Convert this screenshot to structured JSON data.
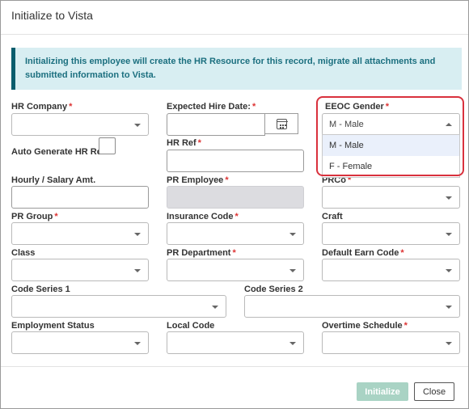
{
  "dialog": {
    "title": "Initialize to Vista",
    "info": "Initializing this employee will create the HR Resource for this record, migrate all attachments and submitted information to Vista."
  },
  "fields": {
    "hr_company": "HR Company",
    "expected_hire_date": "Expected Hire Date:",
    "eeoc_gender": "EEOC Gender",
    "auto_generate_hr_ref": "Auto Generate HR Ref",
    "hr_ref": "HR Ref",
    "hourly_salary": "Hourly / Salary Amt.",
    "pr_employee": "PR Employee",
    "prco": "PRCo",
    "pr_group": "PR Group",
    "insurance_code": "Insurance Code",
    "craft": "Craft",
    "class": "Class",
    "pr_department": "PR Department",
    "default_earn_code": "Default Earn Code",
    "code_series_1": "Code Series 1",
    "code_series_2": "Code Series 2",
    "employment_status": "Employment Status",
    "local_code": "Local Code",
    "overtime_schedule": "Overtime Schedule"
  },
  "required_mark": "*",
  "eeoc_gender": {
    "value": "M - Male",
    "options": [
      "M - Male",
      "F - Female"
    ]
  },
  "buttons": {
    "initialize": "Initialize",
    "close": "Close"
  },
  "colors": {
    "accent": "#0a5d6d",
    "info_bg": "#d8eef2",
    "required": "#d33333",
    "highlight": "#d9313d",
    "primary_disabled": "#a9d3c4"
  }
}
